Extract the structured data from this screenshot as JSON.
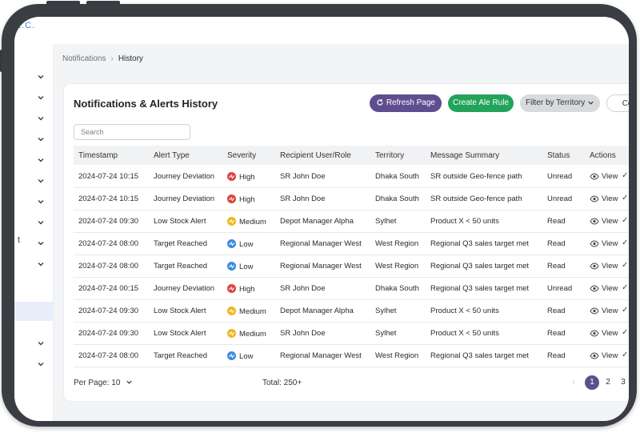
{
  "app": {
    "logo_fragment": "L.C."
  },
  "sidebar": {
    "label_fragment": "t"
  },
  "breadcrumb": {
    "parent": "Notifications",
    "separator": "›",
    "current": "History"
  },
  "card": {
    "title": "Notifications & Alerts History",
    "buttons": {
      "refresh": "Refresh Page",
      "create": "Create Ale Rule",
      "filter": "Filter by Territory",
      "columns": "Colu"
    },
    "search_placeholder": "Search"
  },
  "table": {
    "headers": [
      "Timestamp",
      "Alert Type",
      "Severity",
      "Recipient User/Role",
      "Territory",
      "Message Summary",
      "Status",
      "Actions"
    ],
    "view_label": "View",
    "check_glyph": "✓",
    "rows": [
      {
        "timestamp": "2024-07-24 10:15",
        "type": "Journey Deviation",
        "severity": "High",
        "recipient": "SR John Doe",
        "territory": "Dhaka South",
        "message": "SR outside Geo-fence path",
        "status": "Unread"
      },
      {
        "timestamp": "2024-07-24 10:15",
        "type": "Journey Deviation",
        "severity": "High",
        "recipient": "SR John Doe",
        "territory": "Dhaka South",
        "message": "SR outside Geo-fence path",
        "status": "Unread"
      },
      {
        "timestamp": "2024-07-24 09:30",
        "type": "Low Stock Alert",
        "severity": "Medium",
        "recipient": "Depot Manager Alpha",
        "territory": "Sylhet",
        "message": "Product X < 50 units",
        "status": "Read"
      },
      {
        "timestamp": "2024-07-24 08:00",
        "type": "Target Reached",
        "severity": "Low",
        "recipient": "Regional Manager West",
        "territory": "West Region",
        "message": "Regional Q3 sales target met",
        "status": "Read"
      },
      {
        "timestamp": "2024-07-24 08:00",
        "type": "Target Reached",
        "severity": "Low",
        "recipient": "Regional Manager West",
        "territory": "West Region",
        "message": "Regional Q3 sales target met",
        "status": "Read"
      },
      {
        "timestamp": "2024-07-24 00:15",
        "type": "Journey Deviation",
        "severity": "High",
        "recipient": "SR John Doe",
        "territory": "Dhaka South",
        "message": "Regional Q3 sales target met",
        "status": "Unread"
      },
      {
        "timestamp": "2024-07-24 09:30",
        "type": "Low Stock Alert",
        "severity": "Medium",
        "recipient": "Depot Manager Alpha",
        "territory": "Sylhet",
        "message": "Product X < 50 units",
        "status": "Read"
      },
      {
        "timestamp": "2024-07-24 09:30",
        "type": "Low Stock Alert",
        "severity": "Medium",
        "recipient": "SR John Doe",
        "territory": "Sylhet",
        "message": "Product X < 50 units",
        "status": "Read"
      },
      {
        "timestamp": "2024-07-24 08:00",
        "type": "Target Reached",
        "severity": "Low",
        "recipient": "Regional Manager West",
        "territory": "West Region",
        "message": "Regional Q3 sales target met",
        "status": "Read"
      }
    ]
  },
  "footer": {
    "per_page_label": "Per Page:",
    "per_page_value": "10",
    "total": "Total: 250+",
    "prev_glyph": "‹",
    "pages": [
      "1",
      "2",
      "3"
    ],
    "active_page": "1"
  },
  "colors": {
    "high": "#e0443e",
    "medium": "#f2b51e",
    "low": "#3c8be0",
    "accent": "#5e4e8f",
    "success": "#23a35a"
  },
  "icons": {
    "refresh": "refresh-icon",
    "view": "eye-icon",
    "nav": "chevron-down-icon",
    "check": "check-icon"
  }
}
